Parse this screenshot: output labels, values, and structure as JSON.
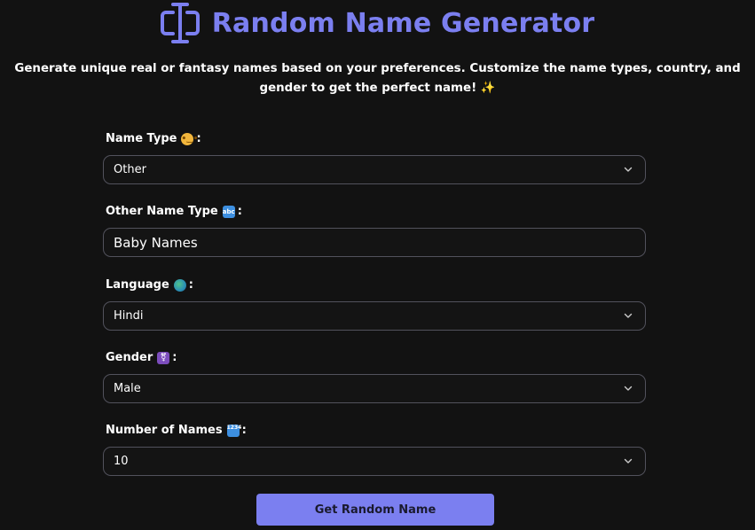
{
  "header": {
    "title": "Random Name Generator",
    "logo_icon": "text-cursor-input-icon",
    "accent_color": "#7b7ff0"
  },
  "subtitle": "Generate unique real or fantasy names based on your preferences. Customize the name types, country, and gender to get the perfect name! ✨",
  "form": {
    "name_type": {
      "label": "Name Type",
      "emoji": "thinking-face-emoji",
      "value": "Other"
    },
    "other_name_type": {
      "label": "Other Name Type",
      "emoji": "abc-emoji",
      "emoji_text": "abc",
      "value": "Baby Names"
    },
    "language": {
      "label": "Language",
      "emoji": "globe-emoji",
      "value": "Hindi"
    },
    "gender": {
      "label": "Gender",
      "emoji": "transgender-symbol-emoji",
      "emoji_text": "⚧",
      "value": "Male"
    },
    "number_of_names": {
      "label": "Number of Names",
      "emoji": "input-numbers-emoji",
      "emoji_text": "1234",
      "value": "10"
    },
    "colon": ":"
  },
  "submit_button": {
    "label": "Get Random Name",
    "background_color": "#7b7ff0"
  }
}
